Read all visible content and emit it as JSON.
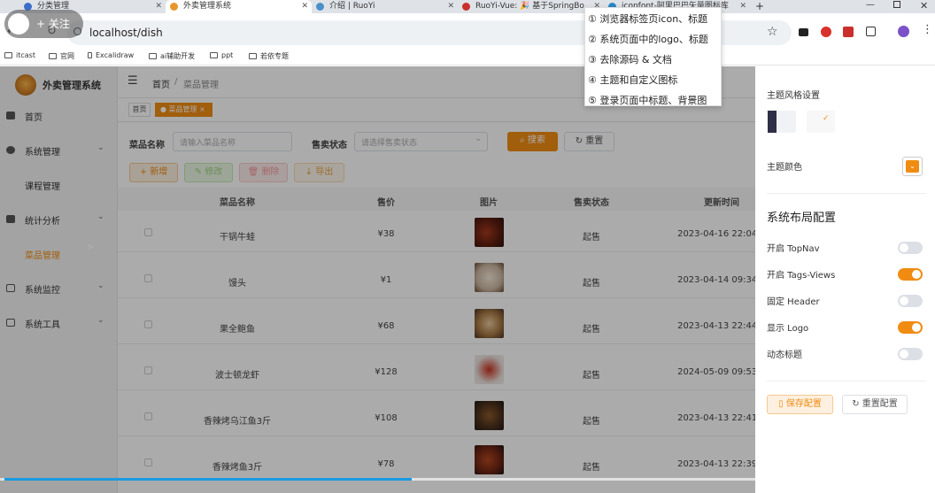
{
  "browser": {
    "tabs": [
      {
        "title": "分类管理",
        "active": false,
        "color": "#3a6ec8"
      },
      {
        "title": "外卖管理系统",
        "active": true,
        "color": "#e8962b"
      },
      {
        "title": "介绍 | RuoYi",
        "active": false,
        "color": "#4a90c8"
      },
      {
        "title": "RuoYi-Vue: 🎉 基于SpringBo",
        "active": false,
        "color": "#c8302c"
      },
      {
        "title": "iconfont-阿里巴巴矢量图标库",
        "active": false,
        "color": "#2a88c8"
      }
    ],
    "url": "localhost/dish",
    "bookmarks": [
      "itcast",
      "官网",
      "Excalidraw",
      "ai辅助开发",
      "ppt",
      "若依专题"
    ]
  },
  "watermark": {
    "label": "+ 关注"
  },
  "sidebar": {
    "app_title": "外卖管理系统",
    "items": [
      {
        "label": "首页",
        "icon": "dashboard-icon",
        "expandable": false,
        "active": false,
        "indent": false
      },
      {
        "label": "系统管理",
        "icon": "gear-icon",
        "expandable": true,
        "active": false,
        "indent": false
      },
      {
        "label": "课程管理",
        "icon": "",
        "expandable": false,
        "active": false,
        "indent": true
      },
      {
        "label": "统计分析",
        "icon": "chart-icon",
        "expandable": true,
        "active": false,
        "indent": false
      },
      {
        "label": "菜品管理",
        "icon": "",
        "expandable": false,
        "active": true,
        "indent": true
      },
      {
        "label": "系统监控",
        "icon": "monitor-icon",
        "expandable": true,
        "active": false,
        "indent": false
      },
      {
        "label": "系统工具",
        "icon": "toolbox-icon",
        "expandable": true,
        "active": false,
        "indent": false
      }
    ]
  },
  "header": {
    "breadcrumb_home": "首页",
    "breadcrumb_sep": "/",
    "breadcrumb_current": "菜品管理"
  },
  "tags": [
    {
      "label": "首页",
      "active": false
    },
    {
      "label": "菜品管理",
      "active": true
    }
  ],
  "search": {
    "name_label": "菜品名称",
    "name_placeholder": "请输入菜品名称",
    "status_label": "售卖状态",
    "status_placeholder": "请选择售卖状态",
    "search_button": "搜索",
    "reset_button": "重置"
  },
  "toolbar": {
    "add": "新增",
    "edit": "修改",
    "delete": "删除",
    "export": "导出"
  },
  "table": {
    "columns": [
      "菜品名称",
      "售价",
      "图片",
      "售卖状态",
      "更新时间"
    ],
    "rows": [
      {
        "name": "干锅牛蛙",
        "price": "¥38",
        "status": "起售",
        "updated": "2023-04-16 22:04:2"
      },
      {
        "name": "馒头",
        "price": "¥1",
        "status": "起售",
        "updated": "2023-04-14 09:34:4"
      },
      {
        "name": "果全鲍鱼",
        "price": "¥68",
        "status": "起售",
        "updated": "2023-04-13 22:44:0"
      },
      {
        "name": "波士顿龙虾",
        "price": "¥128",
        "status": "起售",
        "updated": "2024-05-09 09:53:5"
      },
      {
        "name": "香辣烤乌江鱼3斤",
        "price": "¥108",
        "status": "起售",
        "updated": "2023-04-13 22:41:2"
      },
      {
        "name": "香辣烤鱼3斤",
        "price": "¥78",
        "status": "起售",
        "updated": "2023-04-13 22:39:2"
      }
    ]
  },
  "settings": {
    "theme_style_label": "主题风格设置",
    "theme_color_label": "主题颜色",
    "theme_color": "#f08c12",
    "layout_title": "系统布局配置",
    "options": [
      {
        "label": "开启 TopNav",
        "on": false
      },
      {
        "label": "开启 Tags-Views",
        "on": true
      },
      {
        "label": "固定 Header",
        "on": false
      },
      {
        "label": "显示 Logo",
        "on": true
      },
      {
        "label": "动态标题",
        "on": false
      }
    ],
    "save_button": "保存配置",
    "reset_button": "重置配置"
  },
  "dropdown": {
    "items": [
      "① 浏览器标签页icon、标题",
      "② 系统页面中的logo、标题",
      "③ 去除源码 & 文档",
      "④ 主题和自定义图标",
      "⑤ 登录页面中标题、背景图"
    ]
  },
  "video": {
    "progress": 0.44
  }
}
